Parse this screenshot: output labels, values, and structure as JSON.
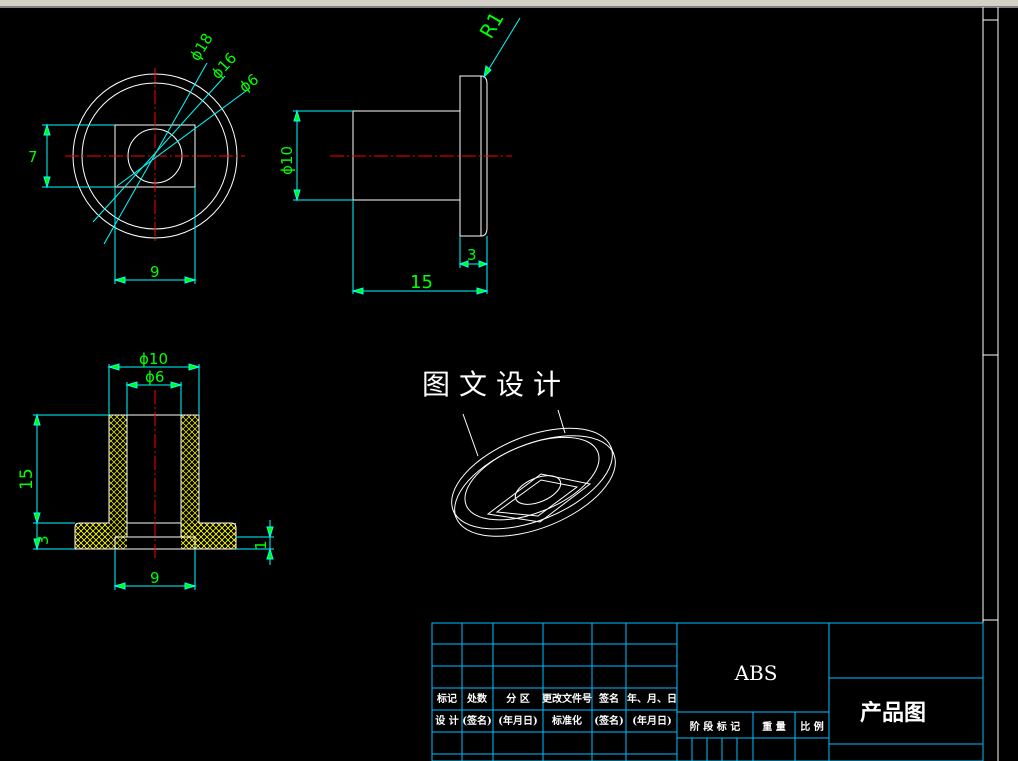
{
  "colors": {
    "background": "#000000",
    "geometry": "#ffffff",
    "dimension": "#00ff00",
    "extension": "#00ffff",
    "centerline": "#ff0000",
    "hatch": "#ffff00",
    "frame": "#00bfff"
  },
  "front_view": {
    "dim_d18": "ϕ18",
    "dim_d16": "ϕ16",
    "dim_d6": "ϕ6",
    "dim_7": "7",
    "dim_9": "9"
  },
  "side_view": {
    "dim_r1": "R1",
    "dim_d10": "ϕ10",
    "dim_3": "3",
    "dim_15": "15"
  },
  "section_view": {
    "dim_d10": "ϕ10",
    "dim_d6": "ϕ6",
    "dim_15": "15",
    "dim_3": "3",
    "dim_1": "1",
    "dim_9": "9"
  },
  "watermark": "图文设计",
  "title_block": {
    "row_headers": [
      "标记",
      "处数",
      "分 区",
      "更改文件号",
      "签名",
      "年、月、日"
    ],
    "row_design": [
      "设 计",
      "(签名)",
      "(年月日)",
      "标准化",
      "(签名)",
      "(年月日)"
    ],
    "stage_headers": [
      "阶 段 标 记",
      "重 量",
      "比 例"
    ],
    "material": "ABS",
    "drawing_name": "产品图"
  }
}
